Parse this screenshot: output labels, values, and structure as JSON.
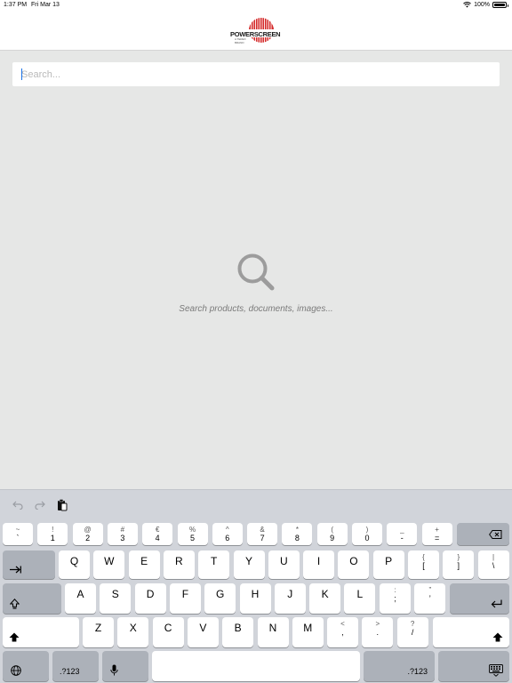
{
  "status_bar": {
    "time": "1:37 PM",
    "date": "Fri Mar 13",
    "battery_text": "100%",
    "battery_level": 1.0
  },
  "header": {
    "logo_text": "POWERSCREEN",
    "logo_subtext": "A TEREX\nBRAND"
  },
  "search": {
    "placeholder": "Search..."
  },
  "empty_state": {
    "icon": "search-icon",
    "message": "Search products, documents, images..."
  },
  "keyboard": {
    "toolbar": [
      {
        "icon": "undo-icon"
      },
      {
        "icon": "redo-icon"
      },
      {
        "icon": "paste-icon"
      }
    ],
    "row1": [
      {
        "top": "~",
        "bottom": "`"
      },
      {
        "top": "!",
        "bottom": "1"
      },
      {
        "top": "@",
        "bottom": "2"
      },
      {
        "top": "#",
        "bottom": "3"
      },
      {
        "top": "€",
        "bottom": "4"
      },
      {
        "top": "%",
        "bottom": "5"
      },
      {
        "top": "^",
        "bottom": "6"
      },
      {
        "top": "&",
        "bottom": "7"
      },
      {
        "top": "*",
        "bottom": "8"
      },
      {
        "top": "(",
        "bottom": "9"
      },
      {
        "top": ")",
        "bottom": "0"
      },
      {
        "top": "_",
        "bottom": "-"
      },
      {
        "top": "+",
        "bottom": "="
      }
    ],
    "row2": [
      "Q",
      "W",
      "E",
      "R",
      "T",
      "Y",
      "U",
      "I",
      "O",
      "P"
    ],
    "row2_punct": [
      {
        "top": "{",
        "bottom": "["
      },
      {
        "top": "}",
        "bottom": "]"
      },
      {
        "top": "|",
        "bottom": "\\"
      }
    ],
    "row3": [
      "A",
      "S",
      "D",
      "F",
      "G",
      "H",
      "J",
      "K",
      "L"
    ],
    "row3_punct": [
      {
        "top": ":",
        "bottom": ";"
      },
      {
        "top": "”",
        "bottom": "’"
      }
    ],
    "row4": [
      "Z",
      "X",
      "C",
      "V",
      "B",
      "N",
      "M"
    ],
    "row4_punct": [
      {
        "top": "<",
        "bottom": ","
      },
      {
        "top": ">",
        "bottom": "."
      },
      {
        "top": "?",
        "bottom": "/"
      }
    ],
    "numbers_label": ".?123"
  }
}
